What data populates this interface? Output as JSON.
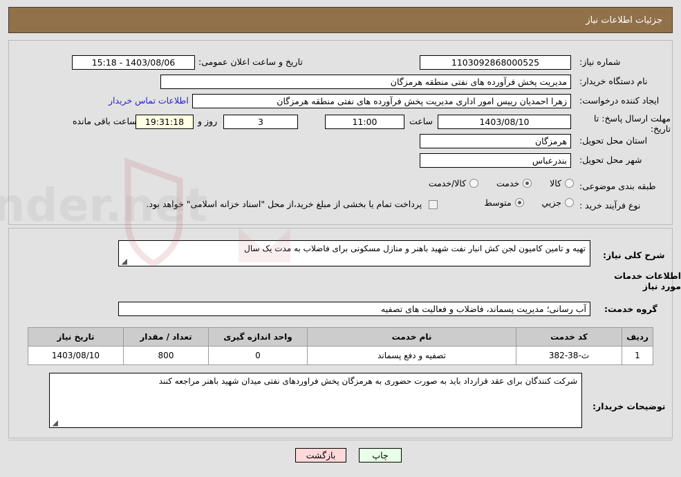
{
  "header": {
    "title": "جزئیات اطلاعات نیاز"
  },
  "form": {
    "need_number_label": "شماره نیاز:",
    "need_number_value": "1103092868000525",
    "announce_label": "تاریخ و ساعت اعلان عمومی:",
    "announce_value": "1403/08/06 - 15:18",
    "buyer_org_label": "نام دستگاه خریدار:",
    "buyer_org_value": "مدیریت پخش فرآورده های نفتی منطقه هرمزگان",
    "creator_label": "ایجاد کننده درخواست:",
    "creator_value": "زهرا احمدیان رییس امور اداری مدیریت پخش فرآورده های نفتی منطقه هرمزگان",
    "contact_link": "اطلاعات تماس خریدار",
    "deadline_label": "مهلت ارسال پاسخ: تا تاریخ:",
    "deadline_date": "1403/08/10",
    "hour_label": "ساعت",
    "hour_value": "11:00",
    "days_value": "3",
    "days_label": "روز و",
    "countdown_value": "19:31:18",
    "remaining_label": "ساعت باقی مانده",
    "province_label": "استان محل تحویل:",
    "province_value": "هرمزگان",
    "city_label": "شهر محل تحویل:",
    "city_value": "بندرعباس",
    "category_label": "طبقه بندی موضوعی:",
    "category_options": [
      {
        "label": "کالا",
        "selected": false
      },
      {
        "label": "خدمت",
        "selected": true
      },
      {
        "label": "کالا/خدمت",
        "selected": false
      }
    ],
    "process_label": "نوع فرآیند خرید :",
    "process_options": [
      {
        "label": "جزیي",
        "selected": false
      },
      {
        "label": "متوسط",
        "selected": true
      }
    ],
    "treasury_checkbox_label": "پرداخت تمام یا بخشی از مبلغ خرید،از محل \"اسناد خزانه اسلامی\" خواهد بود.",
    "treasury_checked": false
  },
  "details": {
    "summary_label": "شرح کلی نیاز:",
    "summary_value": "تهیه و تامین کامیون لجن کش انبار نفت شهید باهنر و منازل مسکونی برای فاضلاب به مدت یک سال",
    "services_section_title": "اطلاعات خدمات مورد نیاز",
    "service_group_label": "گروه خدمت:",
    "service_group_value": "آب رسانی؛ مدیریت پسماند، فاضلاب و فعالیت های تصفیه",
    "buyer_notes_label": "توضیحات خریدار:",
    "buyer_notes_value": "شرکت  کنندگان برای عقد قرارداد باید به صورت حضوری به هرمزگان پخش فراوردهای نفتی میدان شهید باهنر مراجعه کنند"
  },
  "table": {
    "headers": [
      "ردیف",
      "کد خدمت",
      "نام خدمت",
      "واحد اندازه گیری",
      "تعداد / مقدار",
      "تاریخ نیاز"
    ],
    "rows": [
      {
        "index": "1",
        "code": "ث-38-382",
        "name": "تصفیه و دفع پسماند",
        "unit": "0",
        "quantity": "800",
        "date": "1403/08/10"
      }
    ]
  },
  "footer": {
    "print_label": "چاپ",
    "back_label": "بازگشت"
  },
  "watermark": {
    "text": "AriaTender.net"
  }
}
